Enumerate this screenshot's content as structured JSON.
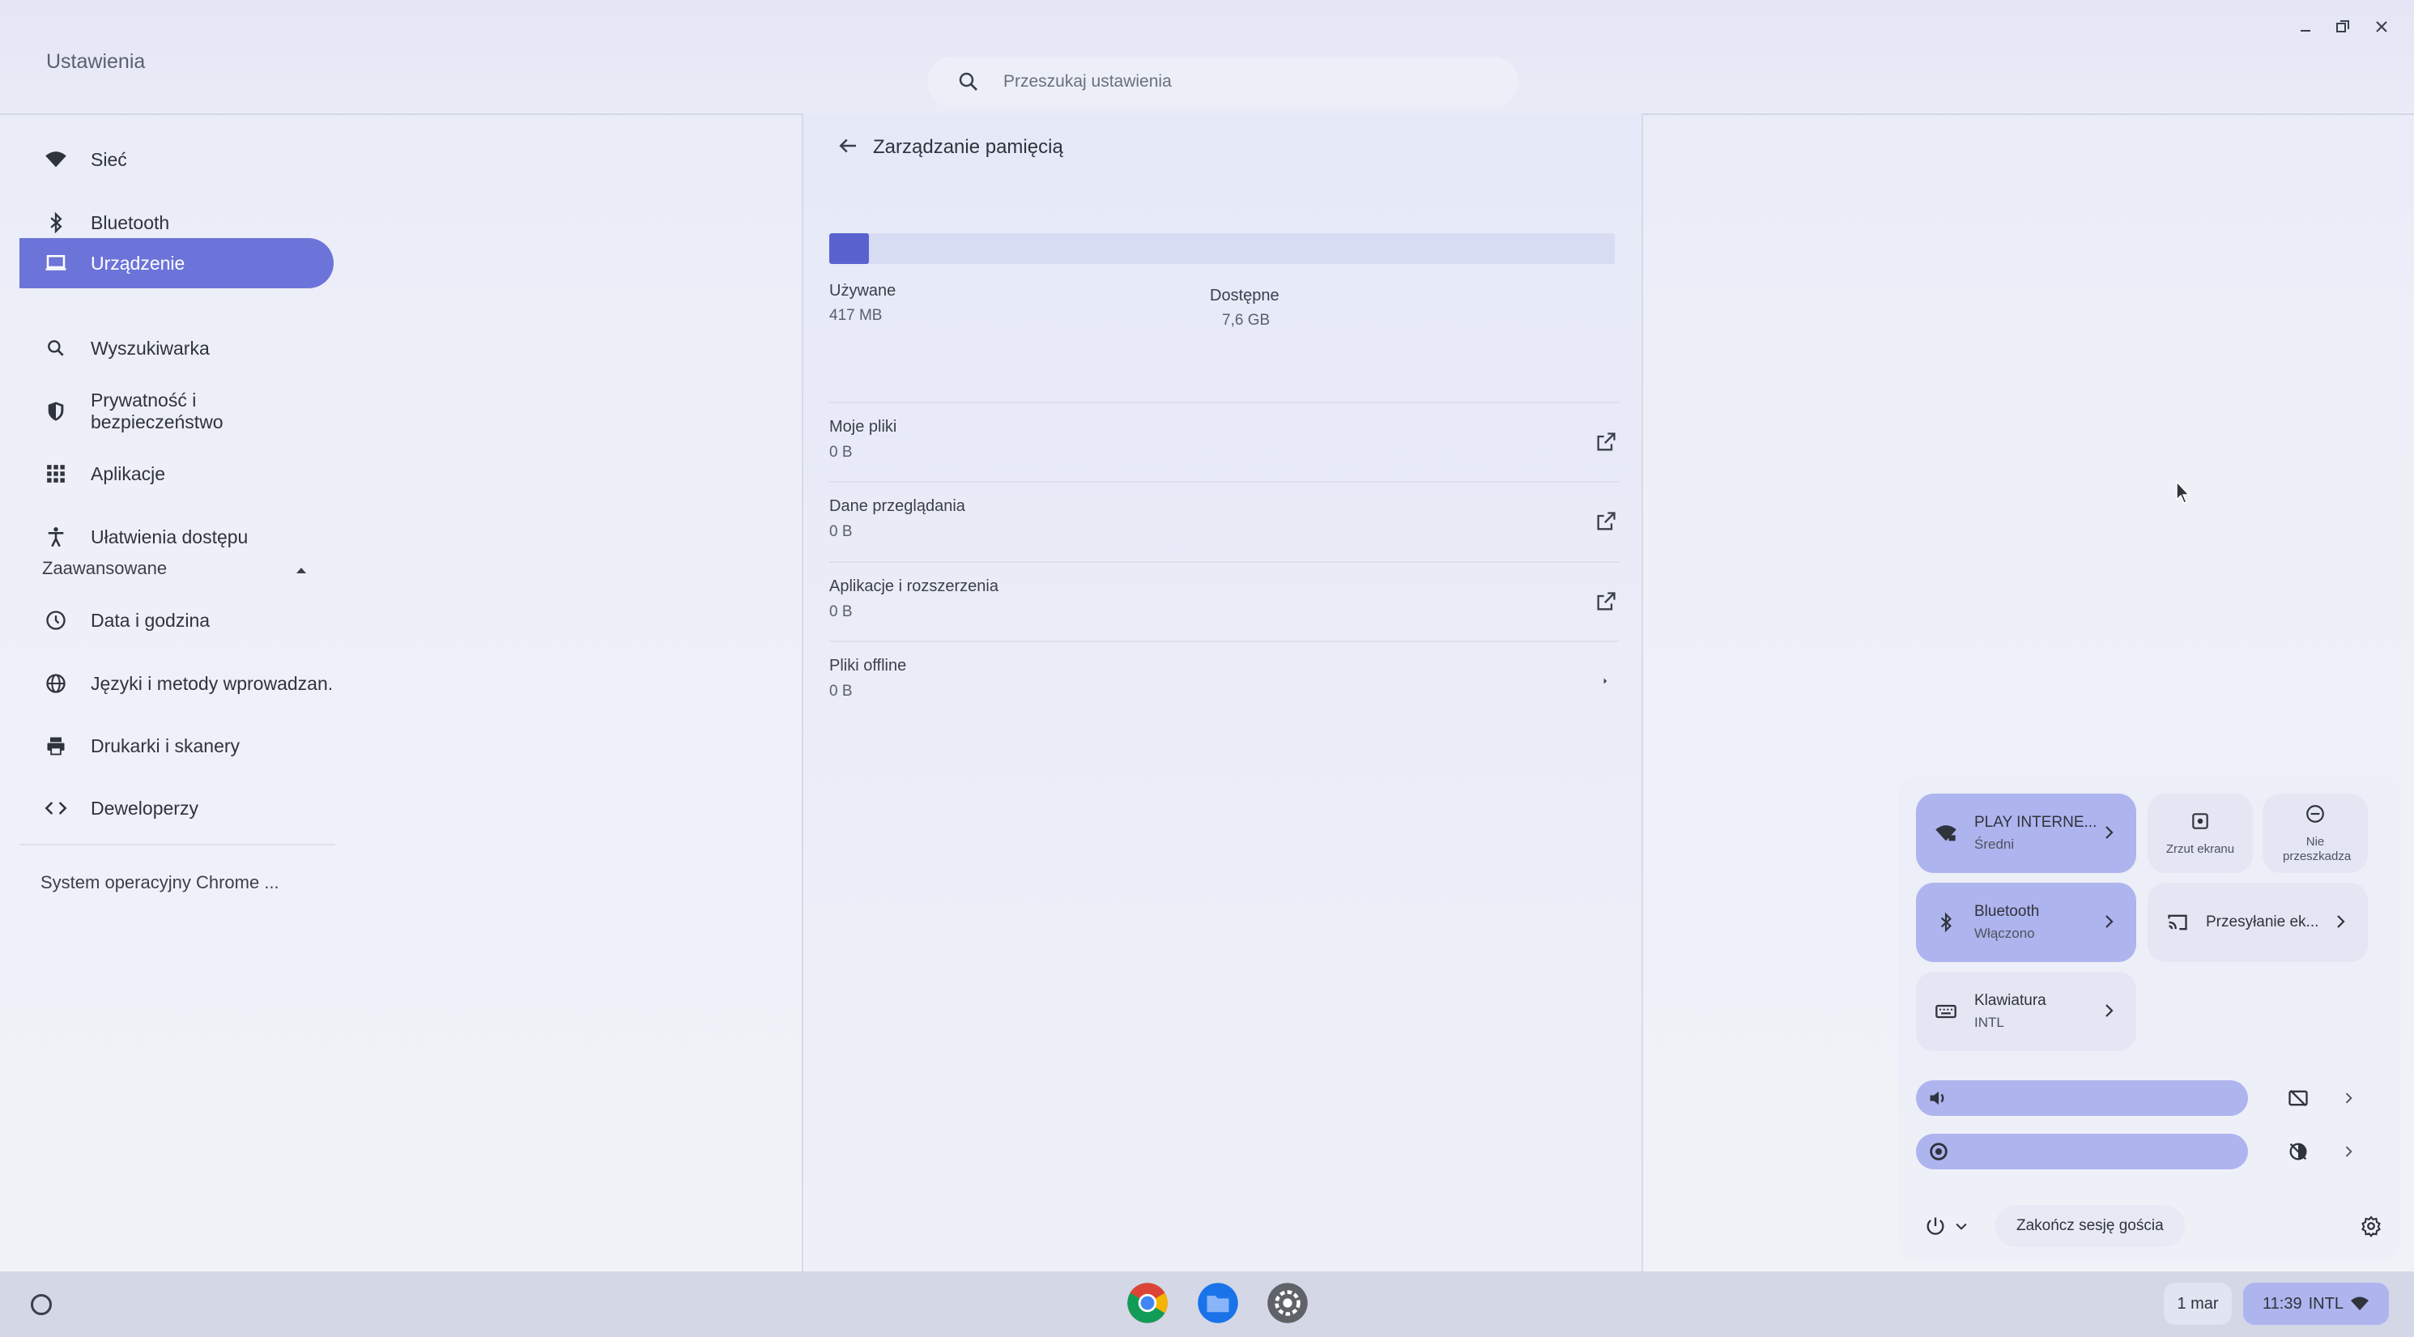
{
  "window": {
    "title": "Ustawienia",
    "search_placeholder": "Przeszukaj ustawienia"
  },
  "sidebar": {
    "items": [
      {
        "label": "Sieć",
        "icon": "wifi-icon"
      },
      {
        "label": "Bluetooth",
        "icon": "bluetooth-icon"
      },
      {
        "label": "Urządzenie",
        "icon": "laptop-icon",
        "active": true
      },
      {
        "label": "Wyszukiwarka",
        "icon": "search-icon"
      },
      {
        "label": "Prywatność i bezpieczeństwo",
        "icon": "shield-icon"
      },
      {
        "label": "Aplikacje",
        "icon": "apps-grid-icon"
      },
      {
        "label": "Ułatwienia dostępu",
        "icon": "accessibility-icon"
      }
    ],
    "advanced_label": "Zaawansowane",
    "advanced_items": [
      {
        "label": "Data i godzina",
        "icon": "clock-icon"
      },
      {
        "label": "Języki i metody wprowadzan.",
        "icon": "globe-icon"
      },
      {
        "label": "Drukarki i skanery",
        "icon": "printer-icon"
      },
      {
        "label": "Deweloperzy",
        "icon": "code-icon"
      }
    ],
    "about_label": "System operacyjny Chrome ..."
  },
  "storage": {
    "title": "Zarządzanie pamięcią",
    "used_label": "Używane",
    "used_value": "417 MB",
    "available_label": "Dostępne",
    "available_value": "7,6 GB",
    "used_fraction": 0.05,
    "rows": [
      {
        "label": "Moje pliki",
        "value": "0 B",
        "icon": "external-link-icon"
      },
      {
        "label": "Dane przeglądania",
        "value": "0 B",
        "icon": "external-link-icon"
      },
      {
        "label": "Aplikacje i rozszerzenia",
        "value": "0 B",
        "icon": "external-link-icon"
      },
      {
        "label": "Pliki offline",
        "value": "0 B",
        "icon": "chevron-right-icon"
      }
    ]
  },
  "quick_settings": {
    "network": {
      "title": "PLAY INTERNE...",
      "subtitle": "Średni"
    },
    "bluetooth": {
      "title": "Bluetooth",
      "subtitle": "Włączono"
    },
    "keyboard": {
      "title": "Klawiatura",
      "subtitle": "INTL"
    },
    "screen_capture": "Zrzut ekranu",
    "do_not_disturb": "Nie przeszkadza",
    "cast": "Przesyłanie ek...",
    "sign_out": "Zakończ sesję gościa",
    "volume_level": 1.0,
    "brightness_level": 1.0
  },
  "shelf": {
    "date": "1 mar",
    "time": "11:39",
    "ime": "INTL"
  },
  "colors": {
    "accent": "#6c74d9",
    "accent_light": "#aeb4ee"
  }
}
